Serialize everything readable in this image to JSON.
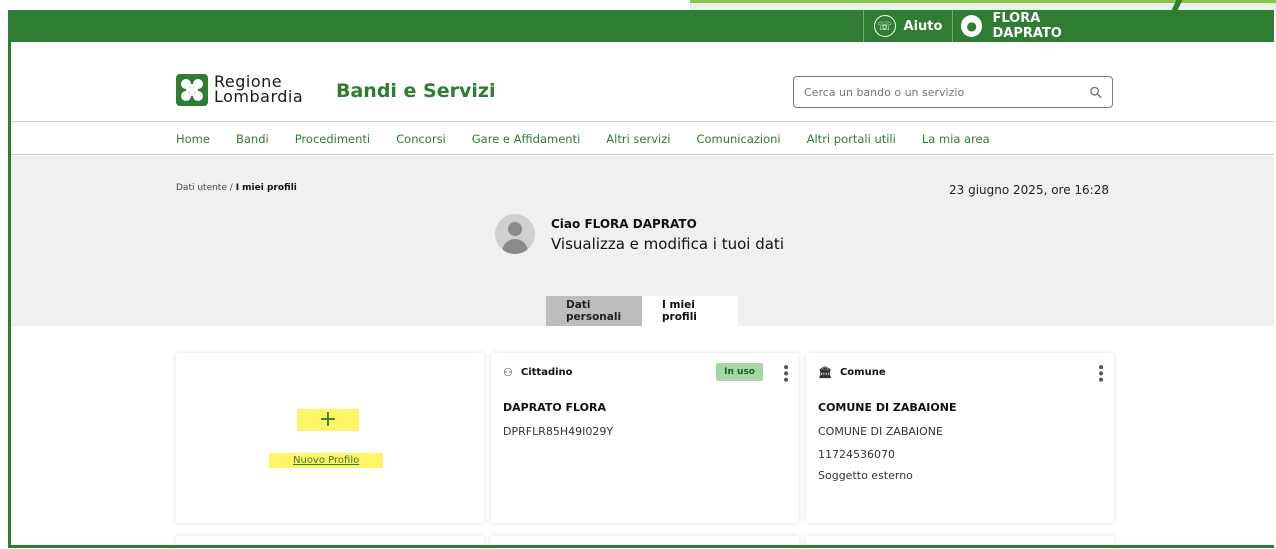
{
  "topbar": {
    "help_label": "Aiuto",
    "user_name": "FLORA DAPRATO"
  },
  "header": {
    "logo_line1": "Regione",
    "logo_line2": "Lombardia",
    "brand": "Bandi e Servizi",
    "search_placeholder": "Cerca un bando o un servizio"
  },
  "nav": {
    "items": [
      "Home",
      "Bandi",
      "Procedimenti",
      "Concorsi",
      "Gare e Affidamenti",
      "Altri servizi",
      "Comunicazioni",
      "Altri portali utili",
      "La mia area"
    ]
  },
  "breadcrumb": {
    "parent": "Dati utente",
    "separator": "/",
    "current": "I miei profili"
  },
  "date": "23 giugno 2025, ore 16:28",
  "profile": {
    "greeting": "Ciao FLORA DAPRATO",
    "subtitle": "Visualizza e modifica i tuoi dati"
  },
  "tabs": [
    "Dati personali",
    "I miei profili"
  ],
  "cards": {
    "new_profile_label": "Nuovo Profilo",
    "new_profile_plus": "+",
    "citizen": {
      "type": "Cittadino",
      "badge": "In uso",
      "name": "DAPRATO FLORA",
      "code": "DPRFLR85H49I029Y"
    },
    "comune": {
      "type": "Comune",
      "name": "COMUNE DI ZABAIONE",
      "line1": "COMUNE DI ZABAIONE",
      "line2": "11724536070",
      "line3": "Soggetto esterno"
    }
  },
  "colors": {
    "brand_green": "#2e7d32",
    "highlight": "#fff566",
    "badge_bg": "#a5d6a7"
  }
}
